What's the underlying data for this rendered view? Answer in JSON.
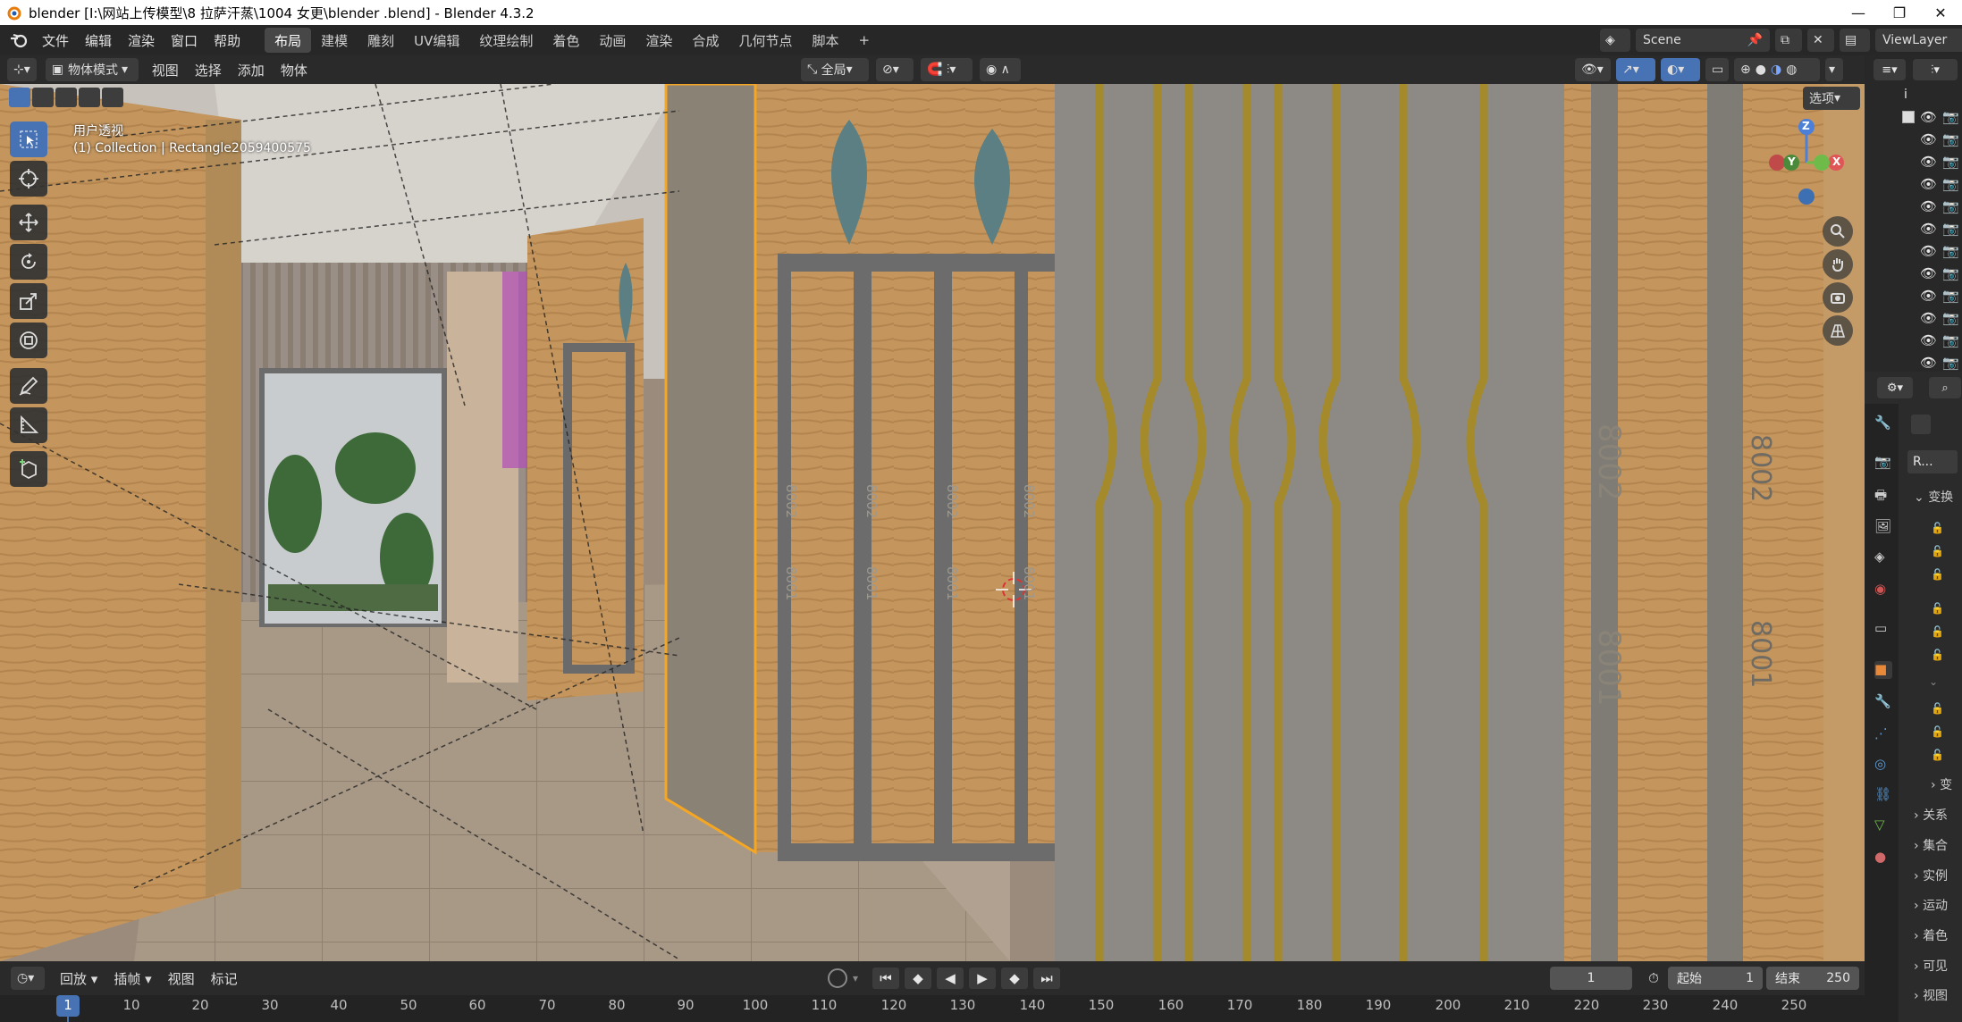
{
  "titlebar": {
    "title": "blender  [I:\\网站上传模型\\8 拉萨汗蒸\\1004 女更\\blender .blend] - Blender 4.3.2",
    "minimize": "—",
    "maximize": "❐",
    "close": "✕"
  },
  "menu": {
    "items": [
      "文件",
      "编辑",
      "渲染",
      "窗口",
      "帮助"
    ],
    "workspaces": [
      "布局",
      "建模",
      "雕刻",
      "UV编辑",
      "纹理绘制",
      "着色",
      "动画",
      "渲染",
      "合成",
      "几何节点",
      "脚本"
    ],
    "active_workspace": "布局",
    "add_workspace": "+",
    "scene": "Scene",
    "view_layer": "ViewLayer"
  },
  "viewport_header": {
    "mode": "物体模式",
    "menus": [
      "视图",
      "选择",
      "添加",
      "物体"
    ],
    "transform_orientation": "全局",
    "options": "选项"
  },
  "viewport": {
    "view_name": "用户透视",
    "object_info": "(1) Collection | Rectangle2059400575",
    "gizmo_axes": {
      "x": "X",
      "y": "Y",
      "z": "Z"
    },
    "panel_labels": [
      "8002",
      "8001",
      "8002",
      "8001",
      "8002",
      "8001",
      "8002",
      "8001"
    ],
    "wall_labels": [
      "8002",
      "8001",
      "8002",
      "8001"
    ]
  },
  "properties": {
    "tab": "R...",
    "sections": [
      "变换",
      "变",
      "关系",
      "集合",
      "实例",
      "运动",
      "着色",
      "可见",
      "视图"
    ]
  },
  "timeline": {
    "menus": [
      "回放",
      "插帧",
      "视图",
      "标记"
    ],
    "current_frame": "1",
    "start_label": "起始",
    "start": "1",
    "end_label": "结束",
    "end": "250",
    "ruler": [
      "1",
      "10",
      "20",
      "30",
      "40",
      "50",
      "60",
      "70",
      "80",
      "90",
      "100",
      "110",
      "120",
      "130",
      "140",
      "150",
      "160",
      "170",
      "180",
      "190",
      "200",
      "210",
      "220",
      "230",
      "240",
      "250"
    ]
  },
  "colors": {
    "accent": "#4772b3",
    "selection_outline": "#f5a623",
    "header_bg": "#2a2a2a"
  }
}
